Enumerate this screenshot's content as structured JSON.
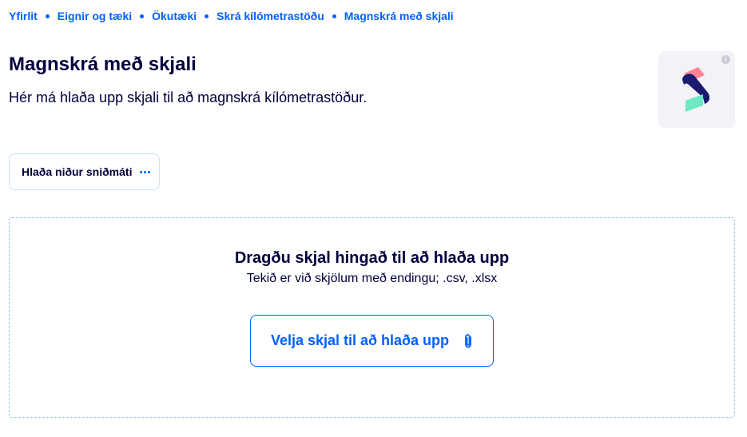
{
  "breadcrumb": {
    "items": [
      {
        "label": "Yfirlit"
      },
      {
        "label": "Eignir og tæki"
      },
      {
        "label": "Ökutæki"
      },
      {
        "label": "Skrá kílómetrastöðu"
      },
      {
        "label": "Magnskrá með skjali"
      }
    ]
  },
  "header": {
    "title": "Magnskrá með skjali",
    "intro": "Hér má hlaða upp skjali til að magnskrá kílómetrastöður.",
    "logo_icon": "organization-logo-s",
    "info_icon": "info-icon"
  },
  "actions": {
    "download_template_label": "Hlaða niður sniðmáti",
    "download_template_icon": "more-dots-icon"
  },
  "dropzone": {
    "title": "Dragðu skjal hingað til að hlaða upp",
    "hint": "Tekið er við skjölum með endingu; .csv, .xlsx",
    "upload_label": "Velja skjal til að hlaða upp",
    "upload_icon": "paperclip-icon"
  },
  "colors": {
    "accent": "#0061ff",
    "text": "#00003c",
    "logo_pink": "#ff8295",
    "logo_navy": "#1a1a6e",
    "logo_green": "#6ee7c3"
  }
}
